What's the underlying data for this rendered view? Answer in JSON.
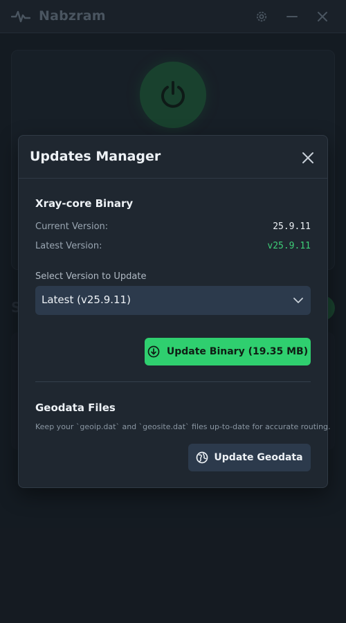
{
  "app": {
    "title": "Nabzram",
    "icons": {
      "logo": "pulse-icon",
      "settings": "gear-icon",
      "minimize": "minus-icon",
      "close": "close-icon"
    }
  },
  "background": {
    "power_icon": "power-icon",
    "partial_letter": "S"
  },
  "modal": {
    "title": "Updates Manager",
    "close_icon": "close-icon",
    "binary": {
      "title": "Xray-core Binary",
      "current_label": "Current Version:",
      "current_value": "25.9.11",
      "latest_label": "Latest Version:",
      "latest_value": "v25.9.11",
      "select_label": "Select Version to Update",
      "select_value": "Latest (v25.9.11)",
      "update_button": "Update Binary (19.35 MB)"
    },
    "geodata": {
      "title": "Geodata Files",
      "description": "Keep your `geoip.dat` and `geosite.dat` files up-to-date for accurate routing.",
      "update_button": "Update Geodata"
    }
  },
  "colors": {
    "accent_green": "#2fcf6f",
    "latest_version_green": "#3ecf78",
    "background": "#181f27",
    "modal": "#1f2730"
  }
}
